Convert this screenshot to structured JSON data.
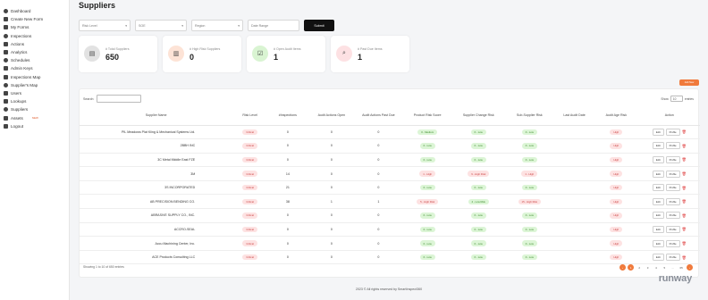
{
  "sidebar": {
    "items": [
      {
        "label": "Dashboard",
        "icon": "home-icon"
      },
      {
        "label": "Create New Form",
        "icon": "doc-plus-icon"
      },
      {
        "label": "My Forms",
        "icon": "doc-icon"
      },
      {
        "label": "Inspections",
        "icon": "clipboard-icon"
      },
      {
        "label": "Actions",
        "icon": "pencil-icon"
      },
      {
        "label": "Analytics",
        "icon": "chart-icon"
      },
      {
        "label": "Schedules",
        "icon": "calendar-icon"
      },
      {
        "label": "Admin Keys",
        "icon": "key-icon"
      },
      {
        "label": "Inspections Map",
        "icon": "map-pin-icon"
      },
      {
        "label": "Supplier's Map",
        "icon": "map-pin-icon"
      },
      {
        "label": "Users",
        "icon": "users-icon"
      },
      {
        "label": "Lookups",
        "icon": "list-icon"
      },
      {
        "label": "Suppliers",
        "icon": "user-icon"
      },
      {
        "label": "Assets",
        "icon": "asset-icon",
        "badge": "NEW"
      },
      {
        "label": "Logout",
        "icon": "logout-icon"
      }
    ]
  },
  "page": {
    "title": "Suppliers"
  },
  "filters": {
    "risk_level": "Risk Level",
    "soe": "SOE",
    "region": "Region",
    "date_range": "Date Range",
    "submit": "Submit"
  },
  "cards": [
    {
      "label": "# Total Suppliers",
      "value": "650",
      "icon": "supplier-icon",
      "color": "#e2e2e2"
    },
    {
      "label": "# High Risk Suppliers",
      "value": "0",
      "icon": "risk-icon",
      "color": "#fde3d6"
    },
    {
      "label": "# Open Audit Items",
      "value": "1",
      "icon": "checklist-icon",
      "color": "#d9f4d2"
    },
    {
      "label": "# Past Due Items",
      "value": "1",
      "icon": "magnifier-icon",
      "color": "#fde1e3"
    }
  ],
  "add_button": "Add New",
  "table": {
    "search_label": "Search:",
    "show_label": "Show",
    "show_value": "10",
    "entries_label": "entries",
    "columns": [
      "Supplier Name",
      "Risk Level",
      "#Inspections",
      "Audit Actions Open",
      "Audit Actions Past Due",
      "Product Risk Score",
      "Supplier Change Risk",
      "Sub-Supplier Risk",
      "Last Audit Date",
      "Audit Age Risk",
      "Action"
    ],
    "rows": [
      {
        "name": "PIL Meadows Plat Kling & Mechanical Systems Ltd.",
        "risk": "Critical",
        "insp": "0",
        "open": "0",
        "past": "0",
        "prod": "0 - Medium",
        "prod_c": "low",
        "chg": "0 - Low",
        "chg_c": "low",
        "sub": "0 - Low",
        "sub_c": "low",
        "date": "",
        "age": "High",
        "age_c": "high"
      },
      {
        "name": "2BBH INC",
        "risk": "Critical",
        "insp": "0",
        "open": "0",
        "past": "0",
        "prod": "0 - Low",
        "prod_c": "low",
        "chg": "0 - Low",
        "chg_c": "low",
        "sub": "0 - Low",
        "sub_c": "low",
        "date": "",
        "age": "High",
        "age_c": "high"
      },
      {
        "name": "3C Metal Middle East FZE",
        "risk": "Critical",
        "insp": "0",
        "open": "0",
        "past": "0",
        "prod": "0 - Low",
        "prod_c": "low",
        "chg": "0 - Low",
        "chg_c": "low",
        "sub": "0 - Low",
        "sub_c": "low",
        "date": "",
        "age": "High",
        "age_c": "high"
      },
      {
        "name": "3M",
        "risk": "Critical",
        "insp": "14",
        "open": "0",
        "past": "0",
        "prod": "1 - High",
        "prod_c": "highrisk",
        "chg": "9 - High Risk",
        "chg_c": "highrisk",
        "sub": "1 - High",
        "sub_c": "highrisk",
        "date": "",
        "age": "High",
        "age_c": "high"
      },
      {
        "name": "3S INCORPORATED",
        "risk": "Critical",
        "insp": "21",
        "open": "0",
        "past": "0",
        "prod": "0 - Low",
        "prod_c": "low",
        "chg": "0 - Low",
        "chg_c": "low",
        "sub": "0 - Low",
        "sub_c": "low",
        "date": "",
        "age": "High",
        "age_c": "high"
      },
      {
        "name": "AB PRECISION BENDING CO.",
        "risk": "Critical",
        "insp": "38",
        "open": "1",
        "past": "1",
        "prod": "5 - High Risk",
        "prod_c": "highrisk",
        "chg": "4 - Low Risk",
        "chg_c": "low",
        "sub": "15 - High Risk",
        "sub_c": "highrisk",
        "date": "",
        "age": "High",
        "age_c": "high"
      },
      {
        "name": "ABRASIVE SUPPLY CO., INC.",
        "risk": "Critical",
        "insp": "0",
        "open": "0",
        "past": "0",
        "prod": "0 - Low",
        "prod_c": "low",
        "chg": "0 - Low",
        "chg_c": "low",
        "sub": "0 - Low",
        "sub_c": "low",
        "date": "",
        "age": "High",
        "age_c": "high"
      },
      {
        "name": "ACCRO-SEAL",
        "risk": "Critical",
        "insp": "0",
        "open": "0",
        "past": "0",
        "prod": "0 - Low",
        "prod_c": "low",
        "chg": "0 - Low",
        "chg_c": "low",
        "sub": "0 - Low",
        "sub_c": "low",
        "date": "",
        "age": "High",
        "age_c": "high"
      },
      {
        "name": "Accu Machining Center, Inc.",
        "risk": "Critical",
        "insp": "0",
        "open": "0",
        "past": "0",
        "prod": "0 - Low",
        "prod_c": "low",
        "chg": "0 - Low",
        "chg_c": "low",
        "sub": "0 - Low",
        "sub_c": "low",
        "date": "",
        "age": "High",
        "age_c": "high"
      },
      {
        "name": "ACE Products Consulting LLC",
        "risk": "Critical",
        "insp": "0",
        "open": "0",
        "past": "0",
        "prod": "0 - Low",
        "prod_c": "low",
        "chg": "0 - Low",
        "chg_c": "low",
        "sub": "0 - Low",
        "sub_c": "low",
        "date": "",
        "age": "High",
        "age_c": "high"
      }
    ],
    "edit_label": "Edit",
    "profile_label": "Profile",
    "info": "Showing 1 to 10 of 650 entries",
    "pages": [
      "1",
      "2",
      "3",
      "4",
      "5",
      "...",
      "65"
    ]
  },
  "footer": {
    "copyright": "2023 © All rights reserved by SmartInspect360"
  },
  "watermark": "runway"
}
